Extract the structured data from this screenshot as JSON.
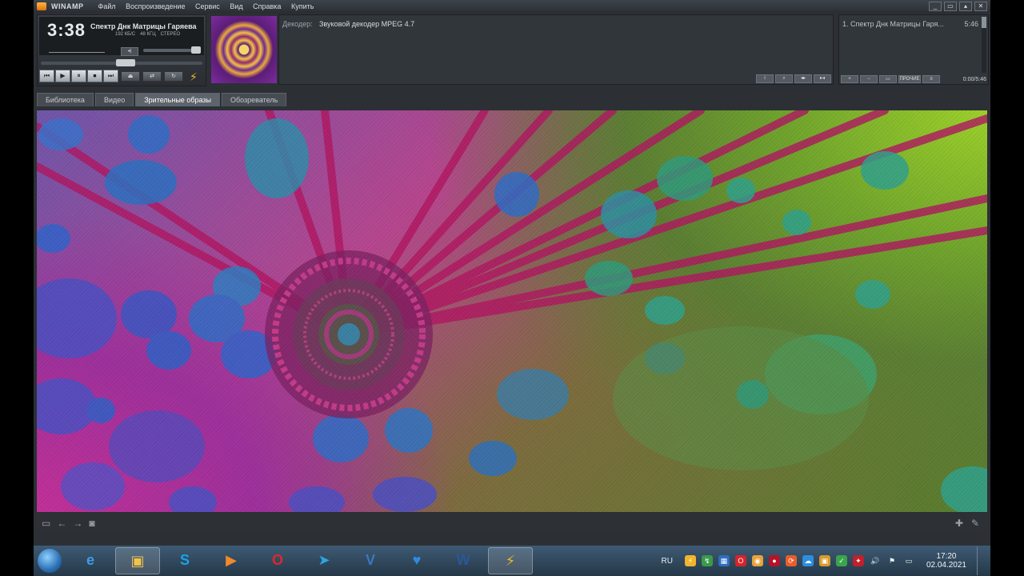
{
  "window": {
    "app_name": "WINAMP",
    "menu": [
      "Файл",
      "Воспроизведение",
      "Сервис",
      "Вид",
      "Справка",
      "Купить"
    ],
    "controls": [
      "_",
      "▭",
      "▴",
      "✕"
    ]
  },
  "player": {
    "time": "3:38",
    "song_title": "Спектр Днк Матрицы Гаряева",
    "bitrate": "192",
    "bitrate_unit": "КБ/С",
    "samplerate": "48",
    "samplerate_unit": "КГЦ",
    "channels": "СТЕРЕО",
    "seek_progress": 0.53,
    "volume_level": 1.0,
    "transport": [
      "⏮",
      "▶",
      "⏸",
      "⏹",
      "⏭"
    ]
  },
  "decoder": {
    "label": "Декодер:",
    "value": "Звуковой декодер MPEG 4.7"
  },
  "playlist": {
    "item": "1. Спектр Днк Матрицы Гаря...",
    "duration": "5:46",
    "buttons": [
      "+",
      "−",
      "▭",
      "ПРОЧИЕ",
      "≡"
    ],
    "total": "0:00/5:46"
  },
  "tabs": [
    "Библиотека",
    "Видео",
    "Зрительные образы",
    "Обозреватель"
  ],
  "active_tab": "Зрительные образы",
  "colors": {
    "panel_bg": "#2c3035",
    "accent": "#f1b52b",
    "taskbar": "#2f4658"
  },
  "taskbar": {
    "apps": [
      {
        "name": "internet-explorer",
        "glyph": "e",
        "color": "#3d9be9"
      },
      {
        "name": "file-explorer",
        "glyph": "▣",
        "color": "#f2c34b"
      },
      {
        "name": "skype",
        "glyph": "S",
        "color": "#1aa3e8"
      },
      {
        "name": "media-player",
        "glyph": "▶",
        "color": "#f08a2b"
      },
      {
        "name": "opera",
        "glyph": "O",
        "color": "#e0262f"
      },
      {
        "name": "telegram",
        "glyph": "➤",
        "color": "#2ca5e0"
      },
      {
        "name": "vpn-app",
        "glyph": "V",
        "color": "#3a78c2"
      },
      {
        "name": "heart-app",
        "glyph": "♥",
        "color": "#2e8be0"
      },
      {
        "name": "word",
        "glyph": "W",
        "color": "#2b5797"
      },
      {
        "name": "winamp",
        "glyph": "⚡",
        "color": "#f1b52b"
      }
    ],
    "language": "RU",
    "time": "17:20",
    "date": "02.04.2021"
  }
}
